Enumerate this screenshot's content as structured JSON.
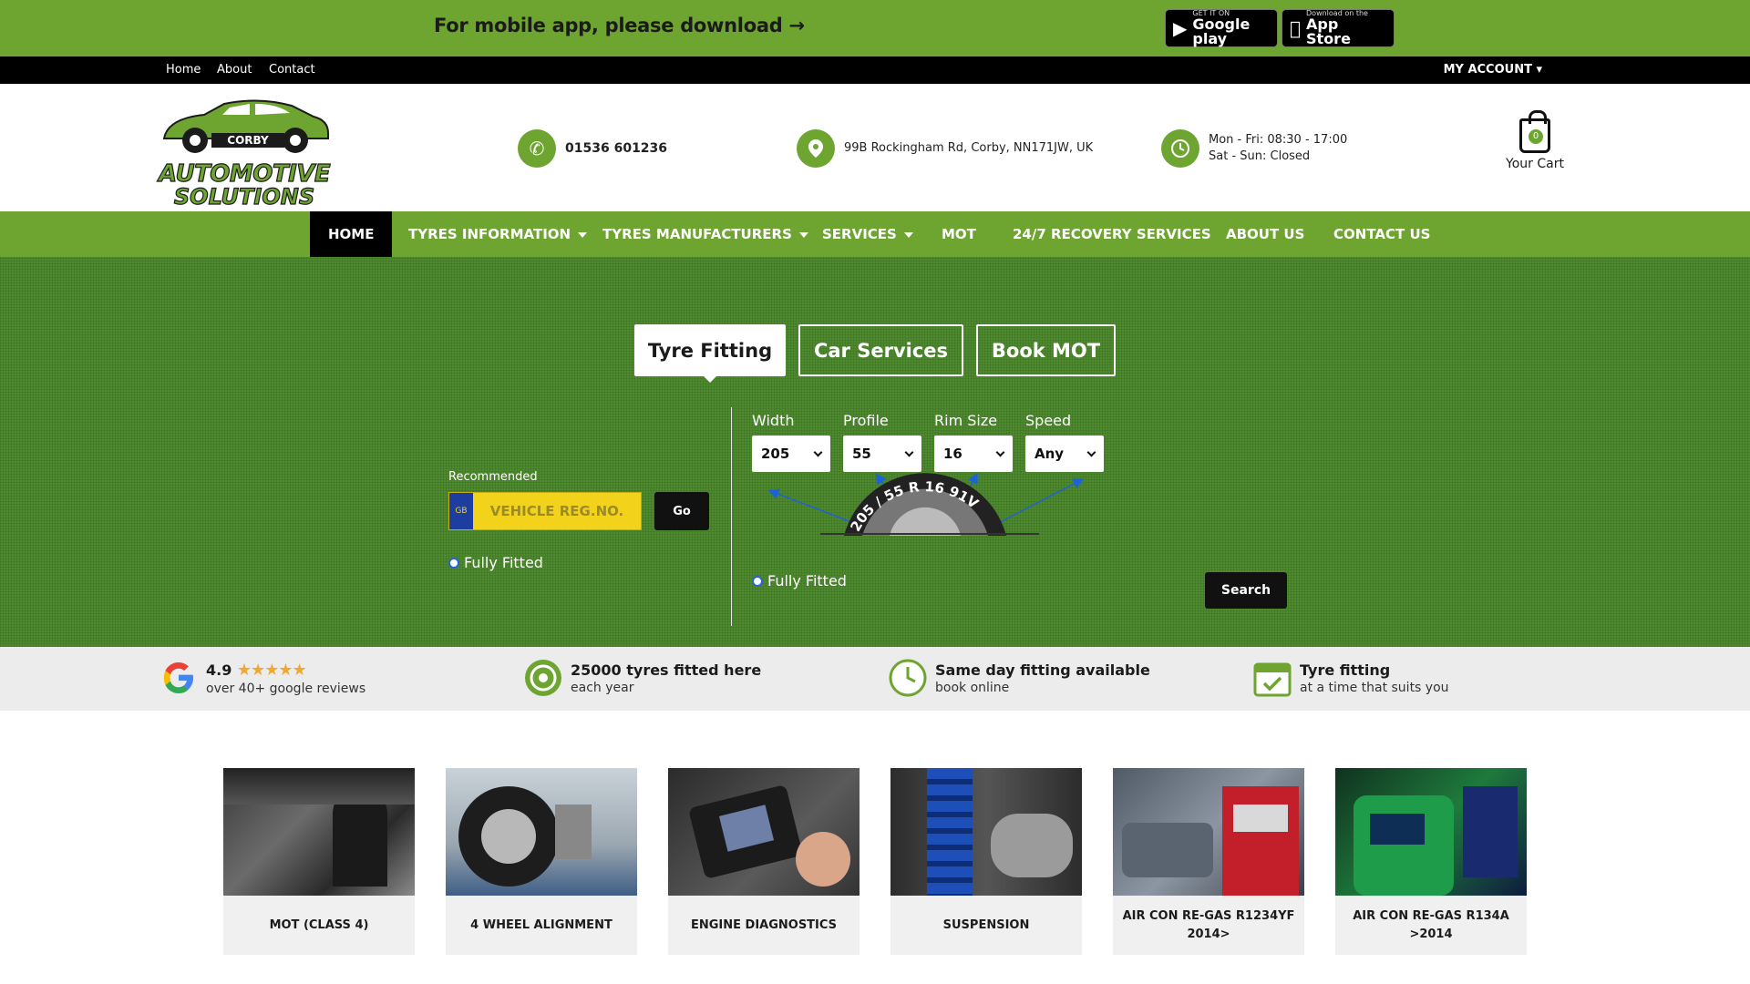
{
  "promo": {
    "text": "For mobile app, please download →",
    "google_play_small": "GET IT ON",
    "google_play_big": "Google play",
    "app_store_small": "Download on the",
    "app_store_big": "App Store"
  },
  "topnav": {
    "links": [
      "Home",
      "About",
      "Contact"
    ],
    "account": "MY ACCOUNT ▾"
  },
  "header": {
    "logo_top": "CORBY",
    "logo_line1": "AUTOMOTIVE",
    "logo_line2": "SOLUTIONS",
    "phone": "01536 601236",
    "address": "99B Rockingham Rd, Corby, NN171JW, UK",
    "hours_weekday": "Mon - Fri: 08:30 - 17:00",
    "hours_weekend": "Sat - Sun: Closed",
    "cart_count": "0",
    "cart_label": "Your Cart"
  },
  "mainnav": {
    "items": [
      "HOME",
      "TYRES INFORMATION",
      "TYRES MANUFACTURERS",
      "SERVICES",
      "MOT",
      "24/7 RECOVERY SERVICES",
      "ABOUT US",
      "CONTACT US"
    ]
  },
  "hero": {
    "tabs": [
      "Tyre Fitting",
      "Car Services",
      "Book MOT"
    ],
    "active_tab": "Tyre Fitting",
    "recommended_label": "Recommended",
    "reg_placeholder": "VEHICLE REG.NO.",
    "eu_label": "GB",
    "go_label": "Go",
    "fully_fitted": "Fully Fitted",
    "selects": [
      {
        "label": "Width",
        "value": "205"
      },
      {
        "label": "Profile",
        "value": "55"
      },
      {
        "label": "Rim Size",
        "value": "16"
      },
      {
        "label": "Speed",
        "value": "Any"
      }
    ],
    "tyre_code": "205 / 55 R 16 91V",
    "search_label": "Search"
  },
  "features": [
    {
      "title": "4.9",
      "sub": "over 40+ google reviews",
      "stars": "★★★★★"
    },
    {
      "title": "25000 tyres fitted here",
      "sub": "each year"
    },
    {
      "title": "Same day fitting available",
      "sub": "book online"
    },
    {
      "title": "Tyre fitting",
      "sub": "at a time that suits you"
    }
  ],
  "cards": [
    "MOT (CLASS 4)",
    "4 WHEEL ALIGNMENT",
    "ENGINE DIAGNOSTICS",
    "SUSPENSION",
    "AIR CON RE-GAS R1234YF 2014>",
    "AIR CON RE-GAS R134A >2014"
  ],
  "colors": {
    "brand_green": "#6ea531",
    "hero_green": "#4d8a2e",
    "black": "#000000",
    "plate_yellow": "#f2d21b"
  }
}
